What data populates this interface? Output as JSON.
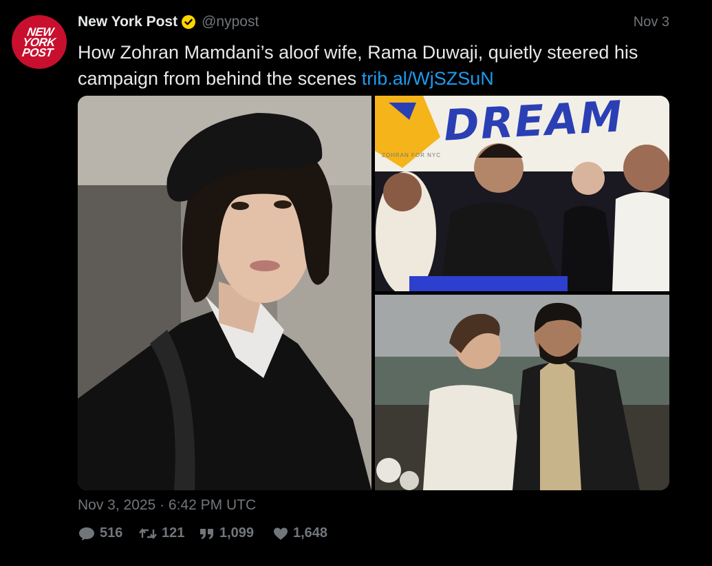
{
  "avatar": {
    "lines": [
      "NEW",
      "YORK",
      "POST"
    ],
    "color": "#c8102e"
  },
  "tweet": {
    "name": "New York Post",
    "handle": "@nypost",
    "date_short": "Nov 3",
    "text": "How Zohran Mamdani’s aloof wife, Rama Duwaji, quietly steered his campaign from behind the scenes ",
    "link": "trib.al/WjSZSuN",
    "timestamp": "Nov 3, 2025 · 6:42 PM UTC"
  },
  "media": {
    "banner_text": "DREAM",
    "banner_small": "ZOHRAN FOR NYC"
  },
  "actions": {
    "replies": "516",
    "retweets": "121",
    "quotes": "1,099",
    "likes": "1,648"
  },
  "colors": {
    "accent": "#1d9bf0",
    "muted": "#71767b",
    "verified": "#ffd400"
  }
}
